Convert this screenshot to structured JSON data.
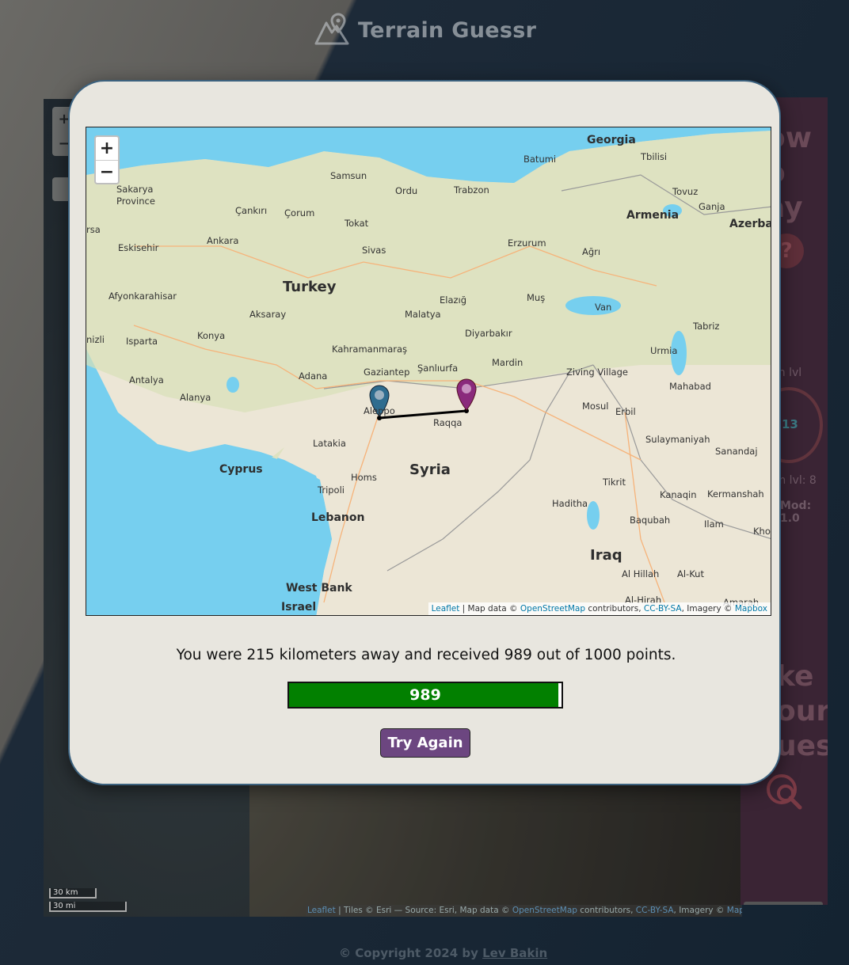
{
  "app": {
    "title": "Terrain Guessr"
  },
  "background_map": {
    "zoom_in": "+",
    "zoom_out": "−",
    "scale_km": "30 km",
    "scale_mi": "30 mi",
    "attribution": {
      "leaflet": "Leaflet",
      "text1": " | Tiles © Esri — Source: Esri, Map data © ",
      "osm": "OpenStreetMap",
      "text2": " contributors, ",
      "license": "CC-BY-SA",
      "text3": ", Imagery © ",
      "mapbox": "Mapbox"
    }
  },
  "side_panel": {
    "how_to_play": "ow\no\nay",
    "zoom_label": "m lvl",
    "zoom_value": "13",
    "zoom_level_label": "om lvl: 8",
    "mod_label": "Mod:",
    "mod_value": "1.0",
    "make_guess": "ke\nour\nuess"
  },
  "footer": {
    "copyright": "© Copyright 2024 by ",
    "author": "Lev Bakin"
  },
  "result_modal": {
    "map": {
      "zoom_in": "+",
      "zoom_out": "−",
      "attribution": {
        "leaflet": "Leaflet",
        "text1": " | Map data © ",
        "osm": "OpenStreetMap",
        "text2": " contributors, ",
        "license": "CC-BY-SA",
        "text3": ", Imagery © ",
        "mapbox": "Mapbox"
      },
      "labels": {
        "countries": [
          "Georgia",
          "Armenia",
          "Azerbai",
          "Turkey",
          "Syria",
          "Iraq",
          "Cyprus",
          "Lebanon",
          "West Bank",
          "Israel"
        ],
        "cities": [
          "Batumi",
          "Tbilisi",
          "Samsun",
          "Ordu",
          "Trabzon",
          "Tovuz",
          "Ganja",
          "Sakarya Province",
          "Çankırı",
          "Çorum",
          "Tokat",
          "rsa",
          "Eskisehir",
          "Ankara",
          "Sivas",
          "Erzurum",
          "Ağrı",
          "Afyonkarahisar",
          "Aksaray",
          "Malatya",
          "Elazığ",
          "Muş",
          "Van",
          "Tabriz",
          "nizli",
          "Isparta",
          "Konya",
          "Kahramanmaraş",
          "Diyarbakır",
          "Urmia",
          "Antalya",
          "Alanya",
          "Adana",
          "Gaziantep",
          "Şanlıurfa",
          "Mardin",
          "Ziving Village",
          "Mahabad",
          "Aleppo",
          "Raqqa",
          "Mosul",
          "Erbil",
          "Latakia",
          "Sulaymaniyah",
          "Sanandaj",
          "Homs",
          "Tikrit",
          "Tripoli",
          "Haditha",
          "Kanaqin",
          "Kermanshah",
          "Baqubah",
          "Ilam",
          "Khor",
          "Al Hillah",
          "Al-Kut",
          "Al-Hirah",
          "Amarah"
        ]
      },
      "markers": {
        "guess_color": "#2e6c8f",
        "actual_color": "#8a2a7c"
      }
    },
    "result_text": "You were 215 kilometers away and received 989 out of 1000 points.",
    "score": "989",
    "score_fraction": 0.989,
    "score_color": "#028000",
    "button_label": "Try Again",
    "button_color": "#6c4680"
  }
}
